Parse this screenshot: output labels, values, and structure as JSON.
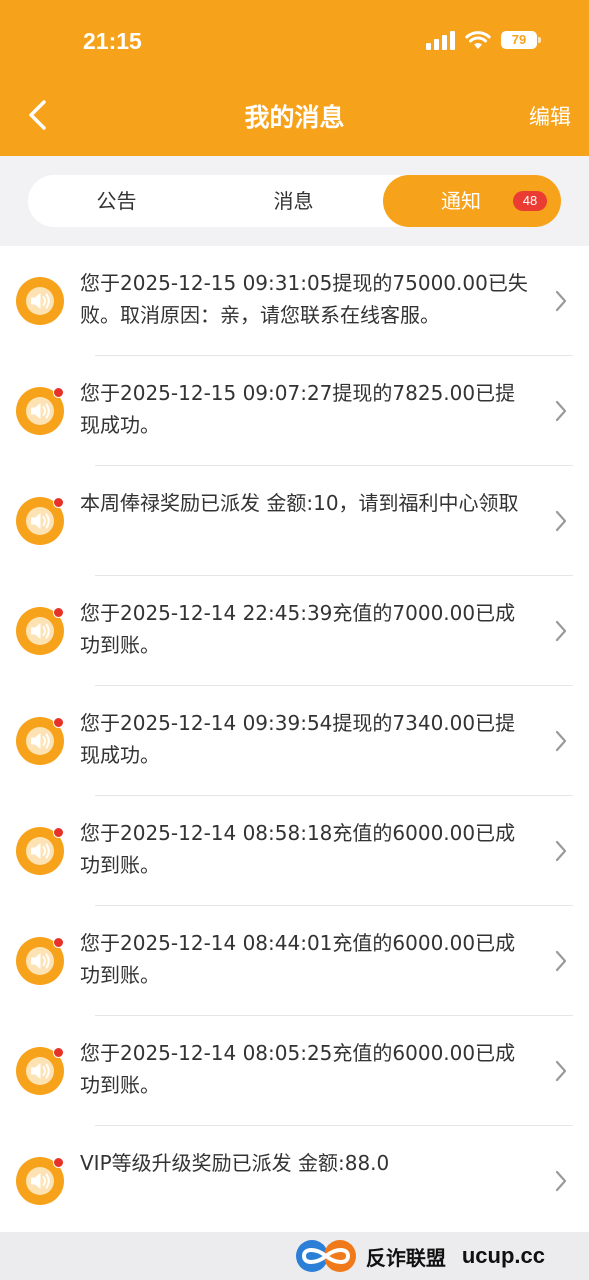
{
  "status_bar": {
    "time": "21:15",
    "battery": "79"
  },
  "header": {
    "title": "我的消息",
    "edit_label": "编辑"
  },
  "tabs": [
    {
      "label": "公告"
    },
    {
      "label": "消息"
    },
    {
      "label": "通知",
      "badge": "48",
      "active": true
    }
  ],
  "messages": [
    {
      "text": "您于2025-12-15 09:31:05提现的75000.00已失败。取消原因：亲，请您联系在线客服。",
      "unread": false
    },
    {
      "text": "您于2025-12-15 09:07:27提现的7825.00已提现成功。",
      "unread": true
    },
    {
      "text": "本周俸禄奖励已派发 金额:10，请到福利中心领取",
      "unread": true
    },
    {
      "text": "您于2025-12-14 22:45:39充值的7000.00已成功到账。",
      "unread": true
    },
    {
      "text": "您于2025-12-14 09:39:54提现的7340.00已提现成功。",
      "unread": true
    },
    {
      "text": "您于2025-12-14 08:58:18充值的6000.00已成功到账。",
      "unread": true
    },
    {
      "text": "您于2025-12-14 08:44:01充值的6000.00已成功到账。",
      "unread": true
    },
    {
      "text": "您于2025-12-14 08:05:25充值的6000.00已成功到账。",
      "unread": true
    },
    {
      "text": "VIP等级升级奖励已派发 金额:88.0",
      "unread": true
    }
  ],
  "watermark": {
    "name": "反诈联盟",
    "site": "ucup.cc"
  },
  "icons": {
    "message_icon": "speaker-icon",
    "back": "chevron-left-icon",
    "row_arrow": "chevron-right-icon"
  },
  "colors": {
    "brand": "#f7a21b",
    "badge": "#ea3c32",
    "unread_dot": "#e63228",
    "background": "#f2f2f4"
  }
}
